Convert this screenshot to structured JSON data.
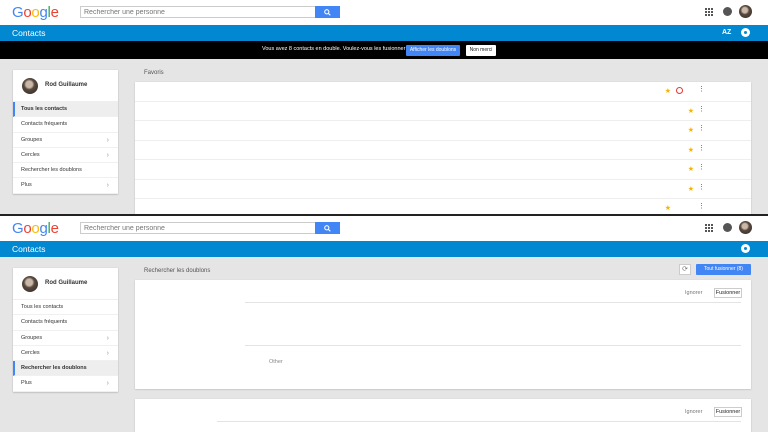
{
  "brand": {
    "letters": [
      {
        "ch": "G",
        "color": "#4285f4"
      },
      {
        "ch": "o",
        "color": "#ea4335"
      },
      {
        "ch": "o",
        "color": "#fbbc05"
      },
      {
        "ch": "g",
        "color": "#4285f4"
      },
      {
        "ch": "l",
        "color": "#34a853"
      },
      {
        "ch": "e",
        "color": "#ea4335"
      }
    ]
  },
  "search": {
    "placeholder": "Rechercher une personne",
    "icon": "search-icon"
  },
  "header": {
    "title": "Contacts",
    "sort_label": "AZ"
  },
  "banner": {
    "message": "Vous avez 8 contacts en double. Voulez-vous les fusionner ?",
    "primary_label": "Afficher les doublons",
    "secondary_label": "Non merci"
  },
  "profile": {
    "name": "Rod Guillaume"
  },
  "nav": {
    "all_contacts": "Tous les contacts",
    "frequent": "Contacts fréquents",
    "groups": "Groupes",
    "circles": "Cercles",
    "find_duplicates": "Rechercher les doublons",
    "more": "Plus"
  },
  "favorites": {
    "label": "Favoris",
    "row_count": 7
  },
  "duplicates": {
    "label": "Rechercher les doublons",
    "merge_all_label": "Tout fusionner (8)",
    "ignore_label": "Ignorer",
    "merge_label": "Fusionner",
    "other_label": "Other"
  },
  "colors": {
    "accent": "#4285f4",
    "header": "#0288d1",
    "star": "#f4b400"
  }
}
